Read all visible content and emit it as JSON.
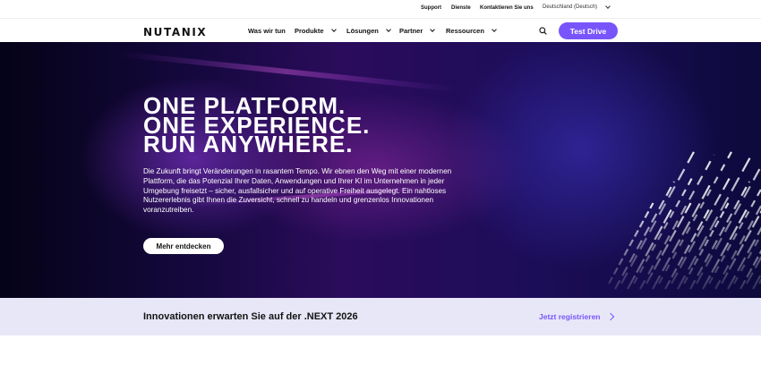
{
  "utility": {
    "support": "Support",
    "services": "Dienste",
    "contact": "Kontaktieren Sie uns",
    "language": "Deutschland (Deutsch)"
  },
  "nav": {
    "logo": "NUTANIX",
    "items": [
      "Was wir tun",
      "Produkte",
      "Lösungen",
      "Partner",
      "Ressourcen"
    ],
    "cta": "Test Drive"
  },
  "hero": {
    "title_lines": [
      "ONE PLATFORM.",
      "ONE EXPERIENCE.",
      "RUN ANYWHERE."
    ],
    "body": "Die Zukunft bringt Veränderungen in rasantem Tempo. Wir ebnen den Weg mit einer modernen Plattform, die das Potenzial Ihrer Daten, Anwendungen und Ihrer KI im Unternehmen in jeder Umgebung freisetzt – sicher, ausfallsicher und auf operative Freiheit ausgelegt. Ein nahtloses Nutzererlebnis gibt Ihnen die Zuversicht, schnell zu handeln und grenzenlos Innovationen voranzutreiben.",
    "button": "Mehr entdecken"
  },
  "banner": {
    "text": "Innovationen erwarten Sie auf der .NEXT 2026",
    "link": "Jetzt registrieren"
  },
  "colors": {
    "accent": "#7855fa",
    "banner_bg": "#e8e7f8",
    "hero_dark": "#0d0a3d"
  },
  "icons": {
    "search": "search-icon",
    "dropdown": "chevron-down-icon",
    "arrow": "chevron-right-icon"
  }
}
